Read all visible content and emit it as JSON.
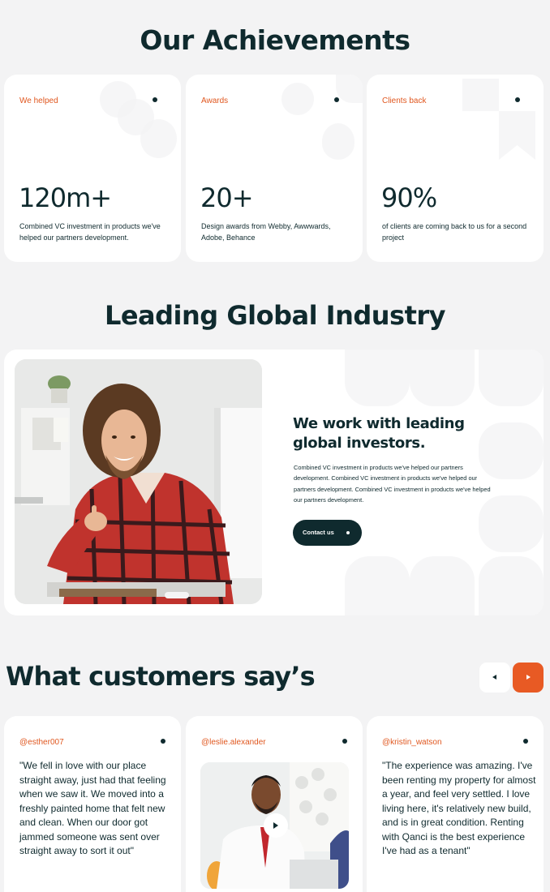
{
  "achievements": {
    "title": "Our Achievements",
    "cards": [
      {
        "label": "We helped",
        "number": "120m+",
        "desc": "Combined VC investment in products we've helped our partners development."
      },
      {
        "label": "Awards",
        "number": "20+",
        "desc": "Design awards from Webby, Awwwards, Adobe, Behance"
      },
      {
        "label": "Clients back",
        "number": "90%",
        "desc": "of clients are coming back to us for a second project"
      }
    ]
  },
  "industry": {
    "title": "Leading Global Industry",
    "heading": "We work with leading global investors.",
    "text": "Combined VC investment in products we've helped our partners development. Combined VC investment in products we've helped our partners development. Combined VC investment in products we've helped our partners development.",
    "button_label": "Contact us"
  },
  "testimonials": {
    "title": "What customers say’s",
    "cards": [
      {
        "handle": "@esther007",
        "quote": "\"We fell in love with our place straight away, just had that feeling when we saw it. We moved into a freshly painted home that felt new and clean. When our door got jammed someone was sent over straight away to sort it out\""
      },
      {
        "handle": "@leslie.alexander"
      },
      {
        "handle": "@kristin_watson",
        "quote": "\"The experience was amazing. I've been renting my property for almost a year, and feel very settled. I love living here, it's relatively new build, and is in great condition. Renting with Qanci is the best experience I've had as a tenant\""
      }
    ]
  },
  "colors": {
    "accent": "#e85a24",
    "dark": "#0f2a2e",
    "background": "#f3f3f4",
    "card": "#ffffff"
  }
}
